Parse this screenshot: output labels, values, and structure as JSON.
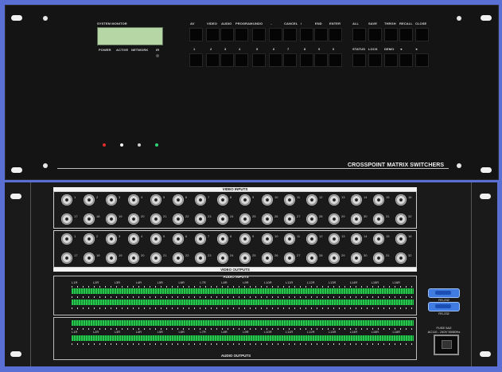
{
  "front_panel": {
    "system_monitor_label": "SYSTEM MONITOR",
    "indicator_labels": [
      "POWER",
      "ACTIVE",
      "NETWORK",
      "IR"
    ],
    "led_colors": [
      "#e12b2b",
      "#f2f2f2",
      "#cfcfcf",
      "#2fd27a"
    ],
    "function_keys": [
      "AV",
      "VIDEO",
      "AUDIO",
      "PROGRAM",
      "UNDO",
      "←",
      "CANCEL",
      "/",
      "END",
      "ENTER"
    ],
    "number_keys": [
      "1",
      "2",
      "3",
      "4",
      "5",
      "6",
      "7",
      "8",
      "9",
      "0"
    ],
    "control_keys_top": [
      "ALL",
      "SAVE",
      "THRGH",
      "RECALL",
      "CLOSE"
    ],
    "control_keys_bottom": [
      "STATUS",
      "LOCK",
      "DEMO",
      "◄",
      "►"
    ],
    "brand_text": "CROSSPOINT MATRIX SWITCHERS"
  },
  "rear_panel": {
    "video_inputs_label": "VIDEO INPUTS",
    "video_outputs_label": "VIDEO OUTPUTS",
    "audio_inputs_label": "AUDIO INPUTS",
    "audio_outputs_label": "AUDIO OUTPUTS",
    "bnc_row1": [
      "1",
      "2",
      "3",
      "4",
      "5",
      "6",
      "7",
      "8",
      "9",
      "10",
      "11",
      "12",
      "13",
      "14",
      "15",
      "16"
    ],
    "bnc_row2": [
      "17",
      "18",
      "19",
      "20",
      "21",
      "22",
      "23",
      "24",
      "25",
      "26",
      "27",
      "28",
      "29",
      "30",
      "31",
      "32"
    ],
    "audio_channels": [
      "L1R",
      "L2R",
      "L3R",
      "L4R",
      "L5R",
      "L6R",
      "L7R",
      "L8R",
      "L9R",
      "L10R",
      "L11R",
      "L12R",
      "L13R",
      "L14R",
      "L15R",
      "L16R"
    ],
    "serial_port_1": "RS-232",
    "serial_port_2": "RS-232",
    "power_label_1": "FUSE 5AZ",
    "power_label_2": "AC110 - 240V 50/60Hz"
  }
}
